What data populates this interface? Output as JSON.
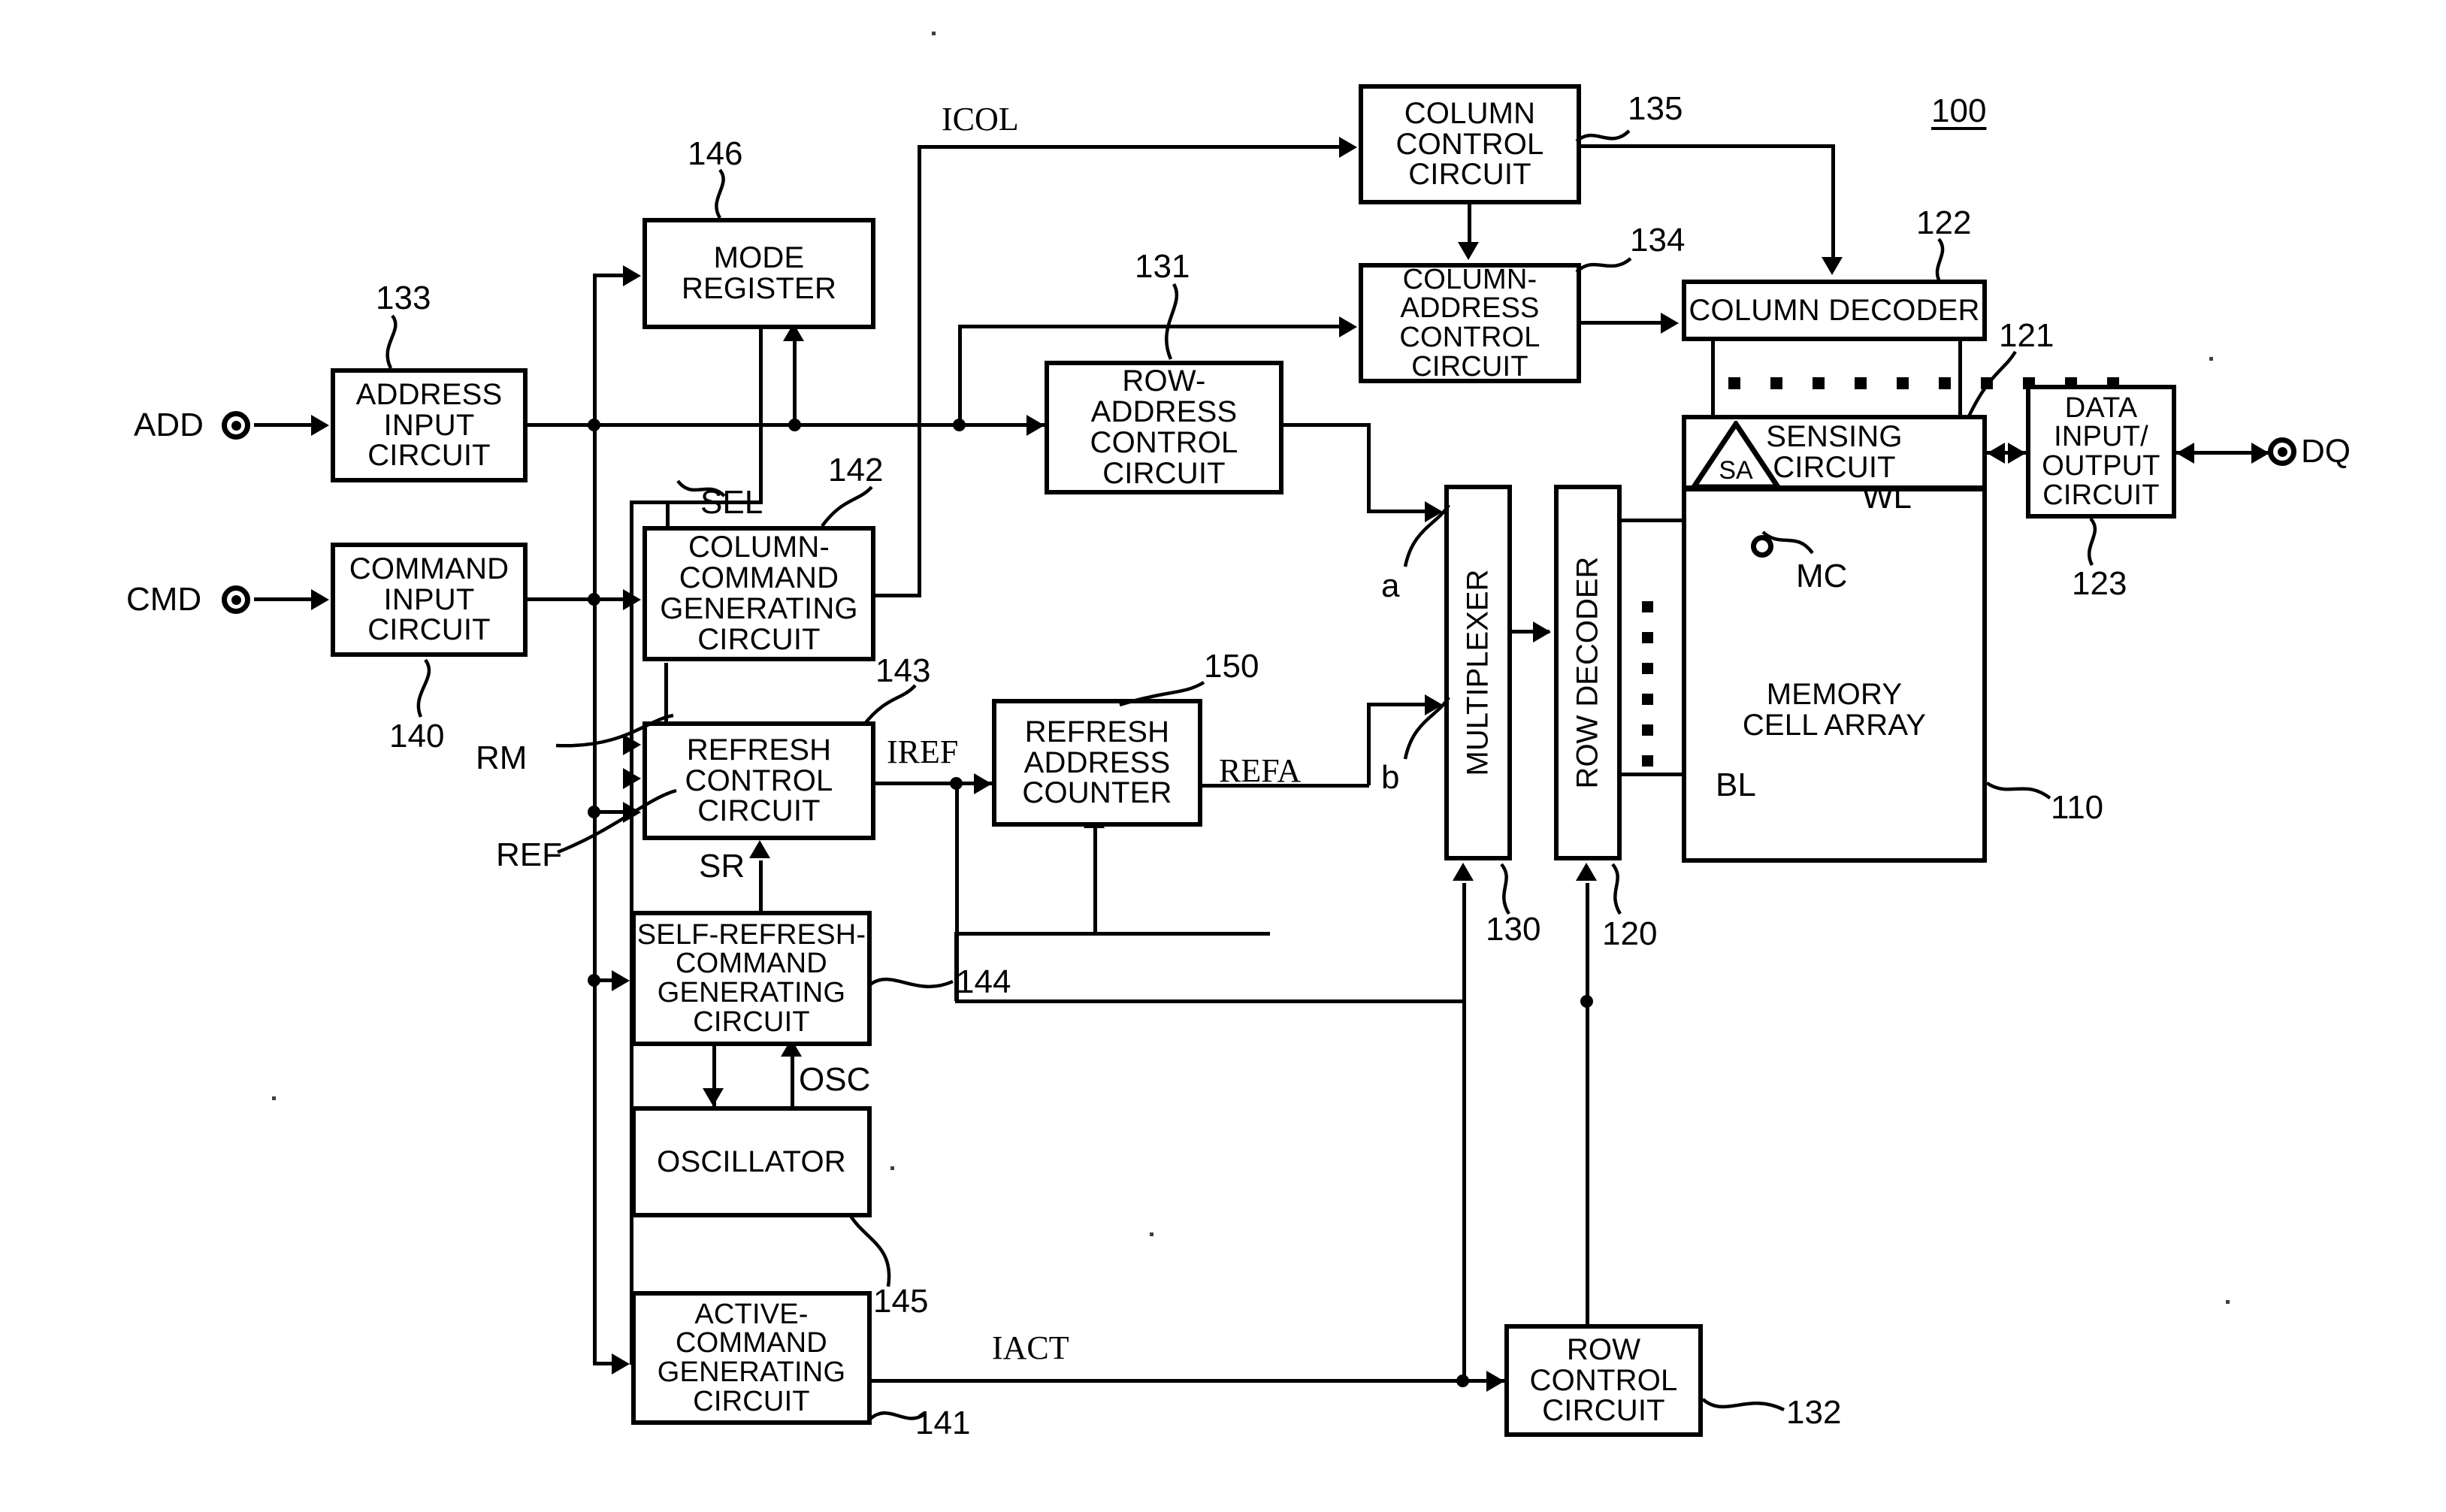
{
  "figure": {
    "device_label": "100",
    "terminals": [
      {
        "name": "ADD"
      },
      {
        "name": "CMD"
      },
      {
        "name": "DQ"
      }
    ],
    "blocks": [
      {
        "id": "address_input",
        "label": "ADDRESS\nINPUT\nCIRCUIT",
        "ref": "133"
      },
      {
        "id": "command_input",
        "label": "COMMAND\nINPUT\nCIRCUIT",
        "ref": "140"
      },
      {
        "id": "mode_register",
        "label": "MODE\nREGISTER",
        "ref": "146"
      },
      {
        "id": "column_command_gen",
        "label": "COLUMN-\nCOMMAND\nGENERATING\nCIRCUIT",
        "ref": "142"
      },
      {
        "id": "refresh_control",
        "label": "REFRESH\nCONTROL\nCIRCUIT",
        "ref": "143"
      },
      {
        "id": "self_refresh_gen",
        "label": "SELF-REFRESH-\nCOMMAND\nGENERATING\nCIRCUIT",
        "ref": "144"
      },
      {
        "id": "oscillator",
        "label": "OSCILLATOR",
        "ref": "145"
      },
      {
        "id": "active_command_gen",
        "label": "ACTIVE-\nCOMMAND\nGENERATING\nCIRCUIT",
        "ref": "141"
      },
      {
        "id": "row_address_control",
        "label": "ROW-\nADDRESS\nCONTROL\nCIRCUIT",
        "ref": "131"
      },
      {
        "id": "refresh_addr_counter",
        "label": "REFRESH\nADDRESS\nCOUNTER",
        "ref": "150"
      },
      {
        "id": "column_control",
        "label": "COLUMN\nCONTROL\nCIRCUIT",
        "ref": "135"
      },
      {
        "id": "column_addr_control",
        "label": "COLUMN-\nADDRESS\nCONTROL\nCIRCUIT",
        "ref": "134"
      },
      {
        "id": "column_decoder",
        "label": "COLUMN DECODER",
        "ref": "122"
      },
      {
        "id": "sensing_circuit",
        "label": "SENSING\nCIRCUIT",
        "ref": "121"
      },
      {
        "id": "memory_cell_array",
        "label": "MEMORY\nCELL ARRAY",
        "ref": "110"
      },
      {
        "id": "data_io",
        "label": "DATA\nINPUT/\nOUTPUT\nCIRCUIT",
        "ref": "123"
      },
      {
        "id": "multiplexer",
        "label": "MULTIPLEXER",
        "ref": "130"
      },
      {
        "id": "row_decoder",
        "label": "ROW DECODER",
        "ref": "120"
      },
      {
        "id": "row_control",
        "label": "ROW\nCONTROL\nCIRCUIT",
        "ref": "132"
      }
    ],
    "signals": [
      {
        "name": "ICOL"
      },
      {
        "name": "SEL"
      },
      {
        "name": "RM"
      },
      {
        "name": "REF"
      },
      {
        "name": "SR"
      },
      {
        "name": "OSC"
      },
      {
        "name": "IREF"
      },
      {
        "name": "REFA"
      },
      {
        "name": "IACT"
      },
      {
        "name": "WL"
      },
      {
        "name": "BL"
      },
      {
        "name": "MC"
      },
      {
        "name": "SA"
      },
      {
        "name": "a"
      },
      {
        "name": "b"
      }
    ],
    "refs": {
      "n100": "100",
      "n110": "110",
      "n120": "120",
      "n121": "121",
      "n122": "122",
      "n123": "123",
      "n130": "130",
      "n131": "131",
      "n132": "132",
      "n133": "133",
      "n134": "134",
      "n135": "135",
      "n140": "140",
      "n141": "141",
      "n142": "142",
      "n143": "143",
      "n144": "144",
      "n145": "145",
      "n146": "146",
      "n150": "150"
    },
    "colors": {
      "ink": "#000000",
      "paper": "#ffffff"
    }
  }
}
